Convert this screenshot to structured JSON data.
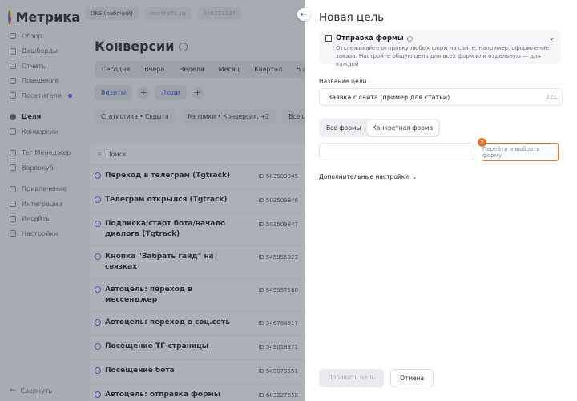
{
  "logo": {
    "text": "Метрика"
  },
  "topbar": {
    "counter_name": "DKS (рабочий)",
    "site": "oss-traffic.ru",
    "counter_id": "106223137"
  },
  "sidebar": {
    "items": [
      {
        "label": "Обзор"
      },
      {
        "label": "Дашборды"
      },
      {
        "label": "Отчеты"
      },
      {
        "label": "Поведение"
      },
      {
        "label": "Посетители"
      },
      {
        "label": "Цели"
      },
      {
        "label": "Конверсии"
      },
      {
        "label": "Тег Менеджер"
      },
      {
        "label": "Варвокуб"
      },
      {
        "label": "Привлечение"
      },
      {
        "label": "Интеграции"
      },
      {
        "label": "Инсайты"
      },
      {
        "label": "Настройки"
      }
    ],
    "collapse_label": "Свернуть"
  },
  "main": {
    "title": "Конверсии",
    "periods": [
      "Сегодня",
      "Вчера",
      "Неделя",
      "Месяц",
      "Квартал",
      "5 авг — 4 сен"
    ],
    "segments": {
      "visits": "Визиты",
      "people": "Люди"
    },
    "filters": [
      "Статистика • Скрыта",
      "Метрики • Конверсия, +2",
      "Все цели"
    ],
    "search_label": "Поиск",
    "rows": [
      {
        "name": "Переход в телеграм (Tgtrack)",
        "id": "ID 503509845"
      },
      {
        "name": "Телеграм открылся (Tgtrack)",
        "id": "ID 503509846"
      },
      {
        "name": "Подписка/старт бота/начало диалога (Tgtrack)",
        "id": "ID 503509847"
      },
      {
        "name": "Кнопка \"Забрать гайд\" на связках",
        "id": "ID 545955323"
      },
      {
        "name": "Автоцель: переход в мессенджер",
        "id": "ID 545957560"
      },
      {
        "name": "Автоцель: переход в соц.сеть",
        "id": "ID 546784817"
      },
      {
        "name": "Посещение ТГ-страницы",
        "id": "ID 549018371"
      },
      {
        "name": "Посещение бота",
        "id": "ID 549073551"
      },
      {
        "name": "Автоцель: отправка формы",
        "id": "ID 603227658"
      }
    ]
  },
  "modal": {
    "title": "Новая цель",
    "goal_type": {
      "title": "Отправка формы",
      "description": "Отслеживайте отправку любых форм на сайте, например, оформление заказа. Настройте общую цель для всех форм или отдельную — для каждой"
    },
    "name_label": "Название цели",
    "name_value": "Заявка с сайта (пример для статьи)",
    "char_count": "221",
    "toggle": {
      "all_forms": "Все формы",
      "specific_form": "Конкретная форма"
    },
    "form_input_value": "",
    "select_form_button": "Перейти и выбрать форму",
    "badge_number": "1",
    "advanced_label": "Дополнительные настройки",
    "add_button": "Добавить цель",
    "cancel_button": "Отмена"
  },
  "colors": {
    "accent": "#e8732c",
    "link": "#3d4bd9",
    "overlay": "#3c4454"
  }
}
